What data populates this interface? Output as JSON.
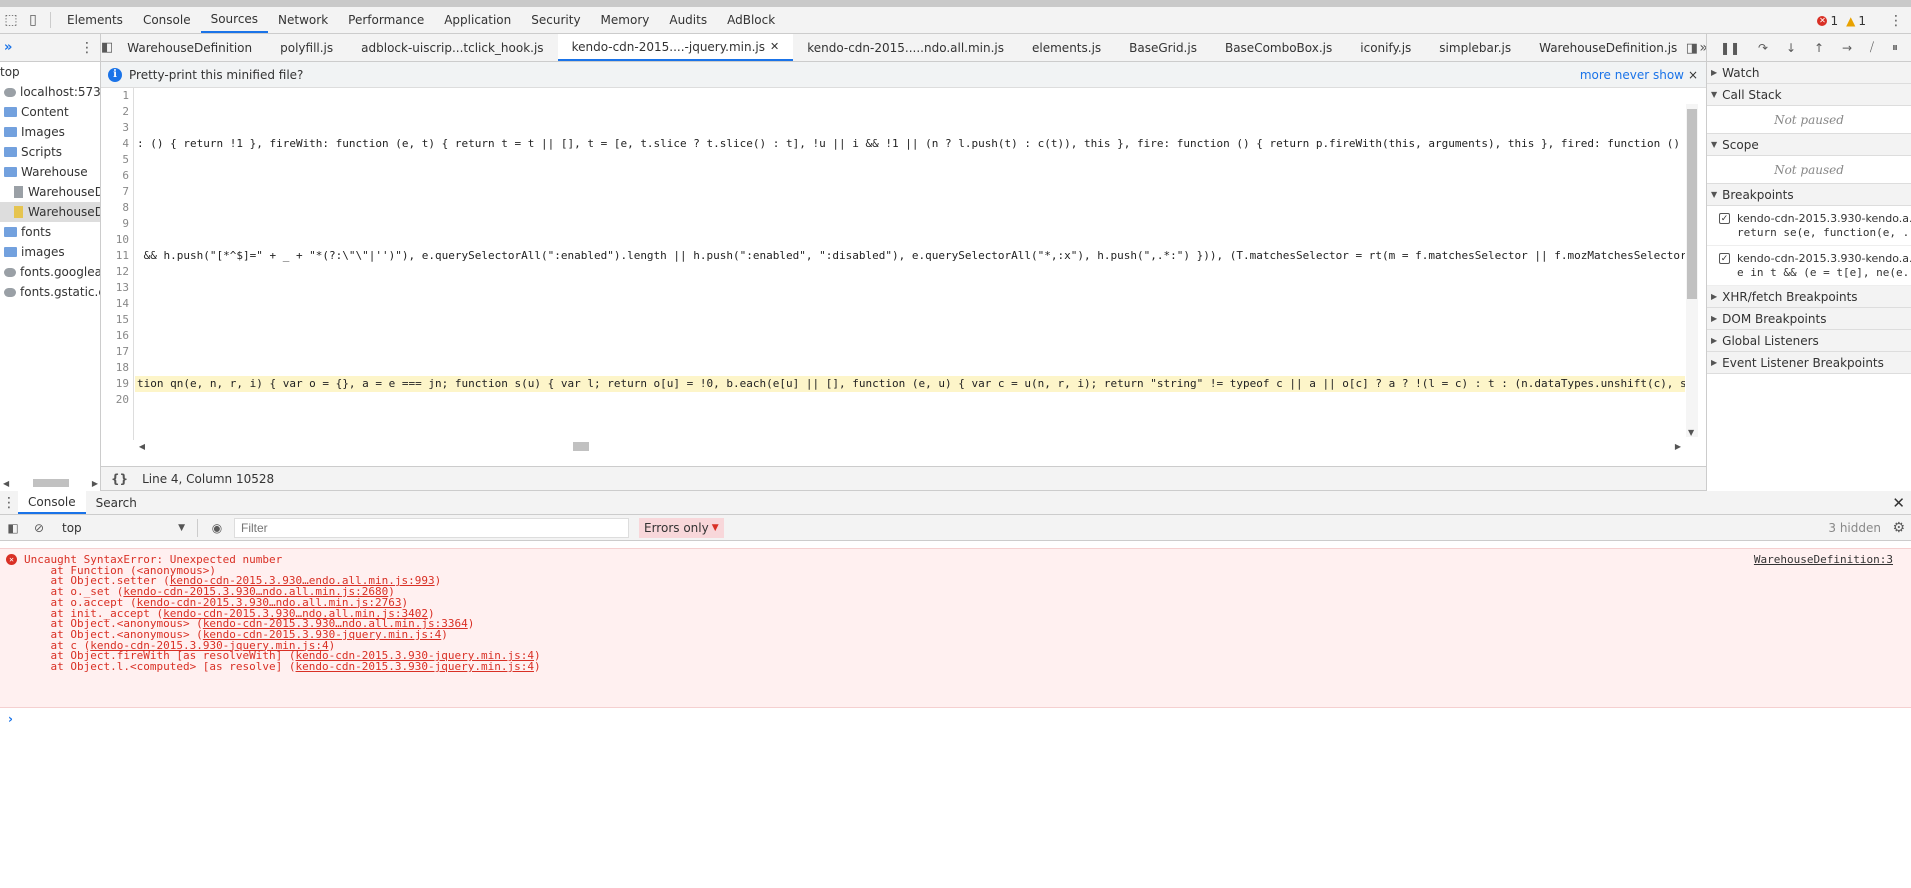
{
  "panel_tabs": [
    "Elements",
    "Console",
    "Sources",
    "Network",
    "Performance",
    "Application",
    "Security",
    "Memory",
    "Audits",
    "AdBlock"
  ],
  "active_panel": "Sources",
  "status_counts": {
    "errors": "1",
    "warnings": "1"
  },
  "navigator": {
    "items": [
      {
        "label": "top",
        "indent": 0,
        "icon": "none"
      },
      {
        "label": "localhost:57348",
        "indent": 1,
        "icon": "cloud"
      },
      {
        "label": "Content",
        "indent": 2,
        "icon": "folder"
      },
      {
        "label": "Images",
        "indent": 2,
        "icon": "folder"
      },
      {
        "label": "Scripts",
        "indent": 2,
        "icon": "folder"
      },
      {
        "label": "Warehouse",
        "indent": 2,
        "icon": "folder"
      },
      {
        "label": "WarehouseD",
        "indent": 3,
        "icon": "file"
      },
      {
        "label": "WarehouseD",
        "indent": 3,
        "icon": "file-yellow",
        "selected": true
      },
      {
        "label": "fonts",
        "indent": 2,
        "icon": "folder"
      },
      {
        "label": "images",
        "indent": 2,
        "icon": "folder"
      },
      {
        "label": "fonts.googleapis.",
        "indent": 1,
        "icon": "cloud"
      },
      {
        "label": "fonts.gstatic.com",
        "indent": 1,
        "icon": "cloud"
      }
    ]
  },
  "editor_tabs": [
    {
      "label": "WarehouseDefinition",
      "active": false,
      "closable": false
    },
    {
      "label": "polyfill.js",
      "active": false,
      "closable": false
    },
    {
      "label": "adblock-uiscrip...tclick_hook.js",
      "active": false,
      "closable": false
    },
    {
      "label": "kendo-cdn-2015....-jquery.min.js",
      "active": true,
      "closable": true
    },
    {
      "label": "kendo-cdn-2015.....ndo.all.min.js",
      "active": false,
      "closable": false
    },
    {
      "label": "elements.js",
      "active": false,
      "closable": false
    },
    {
      "label": "BaseGrid.js",
      "active": false,
      "closable": false
    },
    {
      "label": "BaseComboBox.js",
      "active": false,
      "closable": false
    },
    {
      "label": "iconify.js",
      "active": false,
      "closable": false
    },
    {
      "label": "simplebar.js",
      "active": false,
      "closable": false
    },
    {
      "label": "WarehouseDefinition.js",
      "active": false,
      "closable": false
    }
  ],
  "infobar": {
    "message": "Pretty-print this minified file?",
    "link": "more never show",
    "close": "×"
  },
  "code": {
    "line_numbers": [
      "1",
      "2",
      "3",
      "4",
      "5",
      "6",
      "7",
      "8",
      "9",
      "10",
      "11",
      "12",
      "13",
      "14",
      "15",
      "16",
      "17",
      "18",
      "19",
      "20"
    ],
    "lines": [
      {
        "n": 4,
        "text": ": () { return !1 }, fireWith: function (e, t) { return t = t || [], t = [e, t.slice ? t.slice() : t], !u || i && !1 || (n ? l.push(t) : c(t)), this }, fire: function () { return p.fireWith(this, arguments), this }, fired: function () { r"
      },
      {
        "n": 11,
        "text": " && h.push(\"[*^$]=\" + _ + \"*(?:\\\"\\\"|'')\"), e.querySelectorAll(\":enabled\").length || h.push(\":enabled\", \":disabled\"), e.querySelectorAll(\"*,:x\"), h.push(\",.*:\") })), (T.matchesSelector = rt(m = f.matchesSelector || f.mozMatchesSelector"
      },
      {
        "n": 19,
        "text": "tion qn(e, n, r, i) { var o = {}, a = e === jn; function s(u) { var l; return o[u] = !0, b.each(e[u] || [], function (e, u) { var c = u(n, r, i); return \"string\" != typeof c || a || o[c] ? a ? !(l = c) : t : (n.dataTypes.unshift(c), s(c"
      }
    ],
    "highlighted_line": 19
  },
  "status": {
    "position": "Line 4, Column 10528"
  },
  "debugger": {
    "sections": [
      {
        "label": "Watch"
      },
      {
        "label": "Call Stack",
        "body": "Not paused"
      },
      {
        "label": "Scope",
        "body": "Not paused"
      },
      {
        "label": "Breakpoints"
      }
    ],
    "breakpoints": [
      {
        "file": "kendo-cdn-2015.3.930-kendo.a...",
        "code": "return se(e, function(e, ..."
      },
      {
        "file": "kendo-cdn-2015.3.930-kendo.a...",
        "code": "e in t && (e = t[e], ne(e..."
      }
    ],
    "more_sections": [
      "XHR/fetch Breakpoints",
      "DOM Breakpoints",
      "Global Listeners",
      "Event Listener Breakpoints"
    ]
  },
  "drawer": {
    "tabs": [
      "Console",
      "Search"
    ],
    "active_tab": "Console",
    "context": "top",
    "filter_placeholder": "Filter",
    "level": "Errors only",
    "hidden": "3 hidden"
  },
  "console_message": {
    "source": "WarehouseDefinition:3",
    "lines": [
      {
        "prefix": "Uncaught SyntaxError: Unexpected number",
        "link": "",
        "suffix": ""
      },
      {
        "prefix": "    at Function (<anonymous>)",
        "link": "",
        "suffix": ""
      },
      {
        "prefix": "    at Object.setter (",
        "link": "kendo-cdn-2015.3.930…endo.all.min.js:993",
        "suffix": ")"
      },
      {
        "prefix": "    at o._set (",
        "link": "kendo-cdn-2015.3.930…ndo.all.min.js:2680",
        "suffix": ")"
      },
      {
        "prefix": "    at o.accept (",
        "link": "kendo-cdn-2015.3.930…ndo.all.min.js:2763",
        "suffix": ")"
      },
      {
        "prefix": "    at init._accept (",
        "link": "kendo-cdn-2015.3.930…ndo.all.min.js:3402",
        "suffix": ")"
      },
      {
        "prefix": "    at Object.<anonymous> (",
        "link": "kendo-cdn-2015.3.930…ndo.all.min.js:3364",
        "suffix": ")"
      },
      {
        "prefix": "    at Object.<anonymous> (",
        "link": "kendo-cdn-2015.3.930-jquery.min.js:4",
        "suffix": ")"
      },
      {
        "prefix": "    at c (",
        "link": "kendo-cdn-2015.3.930-jquery.min.js:4",
        "suffix": ")"
      },
      {
        "prefix": "    at Object.fireWith [as resolveWith] (",
        "link": "kendo-cdn-2015.3.930-jquery.min.js:4",
        "suffix": ")"
      },
      {
        "prefix": "    at Object.l.<computed> [as resolve] (",
        "link": "kendo-cdn-2015.3.930-jquery.min.js:4",
        "suffix": ")"
      }
    ]
  },
  "prompt": "›"
}
